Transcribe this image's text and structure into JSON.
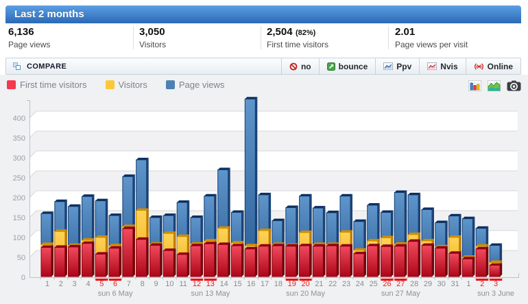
{
  "header": {
    "title": "Last 2 months"
  },
  "stats": [
    {
      "value": "6,136",
      "label": "Page views"
    },
    {
      "value": "3,050",
      "label": "Visitors"
    },
    {
      "value": "2,504",
      "suffix": "(82%)",
      "label": "First time visitors"
    },
    {
      "value": "2.01",
      "label": "Page views per visit"
    }
  ],
  "toolbar": {
    "compare_label": "COMPARE",
    "buttons": [
      {
        "icon": "no-icon",
        "label": "no"
      },
      {
        "icon": "bounce-icon",
        "label": "bounce"
      },
      {
        "icon": "ppv-chart-icon",
        "label": "Ppv"
      },
      {
        "icon": "nvis-chart-icon",
        "label": "Nvis"
      },
      {
        "icon": "online-icon",
        "label": "Online"
      }
    ]
  },
  "legend": [
    {
      "name": "First time visitors",
      "color": "#f4394f"
    },
    {
      "name": "Visitors",
      "color": "#fbc937"
    },
    {
      "name": "Page views",
      "color": "#4d81b4"
    }
  ],
  "colors": {
    "header_top": "#5b9fe3",
    "header_bottom": "#2c69b5",
    "weekend_red": "#e42222",
    "weekday_gray": "#8b8b8b",
    "band_gray": "#f1f1f3",
    "band_white": "#ffffff",
    "grid_line": "#d8d8dc",
    "axis_line": "#bfc2c6"
  },
  "chart_data": {
    "type": "bar",
    "title": "",
    "xlabel": "",
    "ylabel": "",
    "ylim": [
      0,
      450
    ],
    "y_ticks": [
      0,
      50,
      100,
      150,
      200,
      250,
      300,
      350,
      400
    ],
    "grid": true,
    "legend_position": "top-left",
    "categories": [
      "1",
      "2",
      "3",
      "4",
      "5",
      "6",
      "7",
      "8",
      "9",
      "10",
      "11",
      "12",
      "13",
      "14",
      "15",
      "16",
      "17",
      "18",
      "19",
      "20",
      "21",
      "22",
      "23",
      "24",
      "25",
      "26",
      "27",
      "28",
      "29",
      "30",
      "31",
      "1",
      "2",
      "3"
    ],
    "weekend_indices": [
      4,
      5,
      11,
      12,
      18,
      19,
      25,
      26,
      32,
      33
    ],
    "week_markers": [
      {
        "index": 5,
        "label": "sun 6 May"
      },
      {
        "index": 12,
        "label": "sun 13 May"
      },
      {
        "index": 19,
        "label": "sun 20 May"
      },
      {
        "index": 26,
        "label": "sun 27 May"
      },
      {
        "index": 33,
        "label": "sun 3 June"
      }
    ],
    "series": [
      {
        "name": "Page views",
        "values": [
          160,
          190,
          178,
          203,
          192,
          155,
          253,
          295,
          150,
          155,
          188,
          150,
          204,
          270,
          163,
          448,
          207,
          142,
          175,
          204,
          174,
          162,
          204,
          140,
          181,
          163,
          213,
          207,
          170,
          137,
          154,
          147,
          123,
          80
        ],
        "front_top": "#5e95ca",
        "front_bottom": "#2a5c96",
        "stroke": "#123c70",
        "side": "#1c4377",
        "top": "#0c2f5e"
      },
      {
        "name": "Visitors",
        "values": [
          82,
          115,
          80,
          93,
          100,
          79,
          127,
          168,
          83,
          110,
          102,
          83,
          91,
          123,
          86,
          79,
          117,
          82,
          80,
          112,
          82,
          82,
          113,
          68,
          91,
          99,
          83,
          107,
          91,
          76,
          100,
          50,
          78,
          37
        ],
        "front_top": "#fdd458",
        "front_bottom": "#f3a912",
        "stroke": "#d28b00",
        "side": "#bd7c00",
        "top": "#d18d00"
      },
      {
        "name": "First time visitors",
        "values": [
          75,
          75,
          76,
          85,
          58,
          73,
          122,
          95,
          80,
          67,
          57,
          79,
          84,
          82,
          79,
          71,
          78,
          79,
          78,
          79,
          78,
          79,
          78,
          59,
          79,
          77,
          78,
          90,
          80,
          73,
          60,
          46,
          71,
          30
        ],
        "front_top": "#f14a5e",
        "front_bottom": "#ab0617",
        "stroke": "#8e0013",
        "side": "#740009",
        "top": "#8f0013"
      }
    ]
  }
}
